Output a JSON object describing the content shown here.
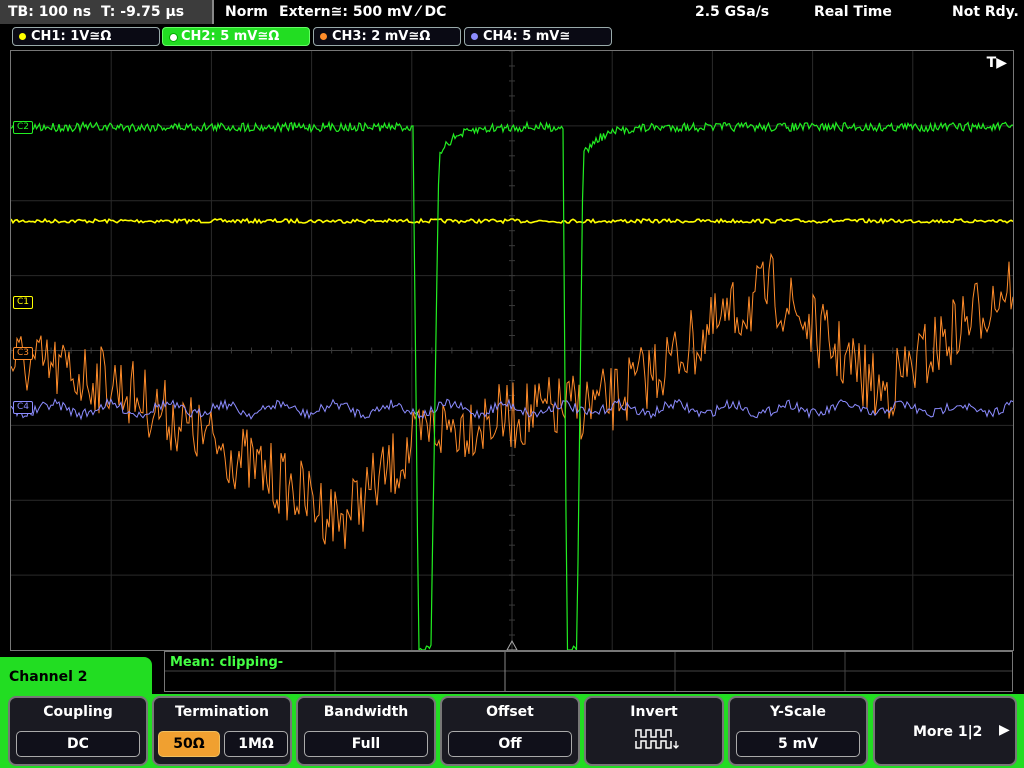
{
  "status": {
    "timebase": "TB: 100 ns",
    "trigger_time": "T: -9.75 µs",
    "trigger_mode": "Norm",
    "trigger_source": "Extern≅: 500 mV ⁄ DC",
    "sample_rate": "2.5 GSa/s",
    "acq_mode": "Real Time",
    "state": "Not Rdy."
  },
  "channels": [
    {
      "label": "CH1: 1V≅Ω",
      "color": "#ffff00",
      "marker": "C1"
    },
    {
      "label": "CH2: 5 mV≅Ω",
      "color": "#22ee22",
      "marker": "C2"
    },
    {
      "label": "CH3: 2 mV≅Ω",
      "color": "#ff8c2a",
      "marker": "C3"
    },
    {
      "label": "CH4: 5 mV≅",
      "color": "#8c8cff",
      "marker": "C4"
    }
  ],
  "trigger_marker": "T▶",
  "measurement": {
    "text": "Mean: clipping-"
  },
  "menu": {
    "title": "Channel 2"
  },
  "softkeys": {
    "coupling": {
      "title": "Coupling",
      "value": "DC"
    },
    "termination": {
      "title": "Termination",
      "opt1": "50Ω",
      "opt2": "1MΩ",
      "selected": "50Ω"
    },
    "bandwidth": {
      "title": "Bandwidth",
      "value": "Full"
    },
    "offset": {
      "title": "Offset",
      "value": "Off"
    },
    "invert": {
      "title": "Invert"
    },
    "yscale": {
      "title": "Y-Scale",
      "value": "5 mV"
    },
    "more": {
      "label": "More 1|2"
    }
  }
}
